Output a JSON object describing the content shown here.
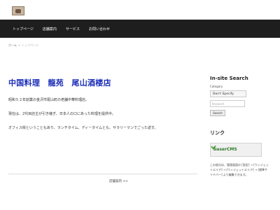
{
  "nav": {
    "items": [
      {
        "label": "トップページ"
      },
      {
        "label": "店舗案内"
      },
      {
        "label": "サービス"
      },
      {
        "label": "お問い合わせ"
      }
    ]
  },
  "breadcrumb": {
    "home": "ホーム",
    "separator": ">",
    "current": "トップページ"
  },
  "main": {
    "title": "中国料理　龍苑　尾山酒楼店",
    "paragraphs": [
      "昭和５２年創業の金沢市尾山町の老舗中華料理店。",
      "現在は、2代目店主が引き継ぎ、日本人の口にあった料理を提供中。",
      "オフィス街ということもあり、ランチタイム、ディータイムとも、サラリーマンでごった返す。"
    ],
    "next_link": "店舗案内 >>"
  },
  "sidebar": {
    "search_title": "In-site Search",
    "category_label": "Category",
    "category_value": "Don't Specify",
    "keyword_placeholder": "Keyword",
    "search_button": "Search",
    "link_title": "リンク",
    "banner_text": "baserCMS",
    "note": "この部分は、管理画面の [設定] → [ウィジェットエリア] → [ウィジェットエリア] → [標準サイドバー] より編集できます。"
  }
}
